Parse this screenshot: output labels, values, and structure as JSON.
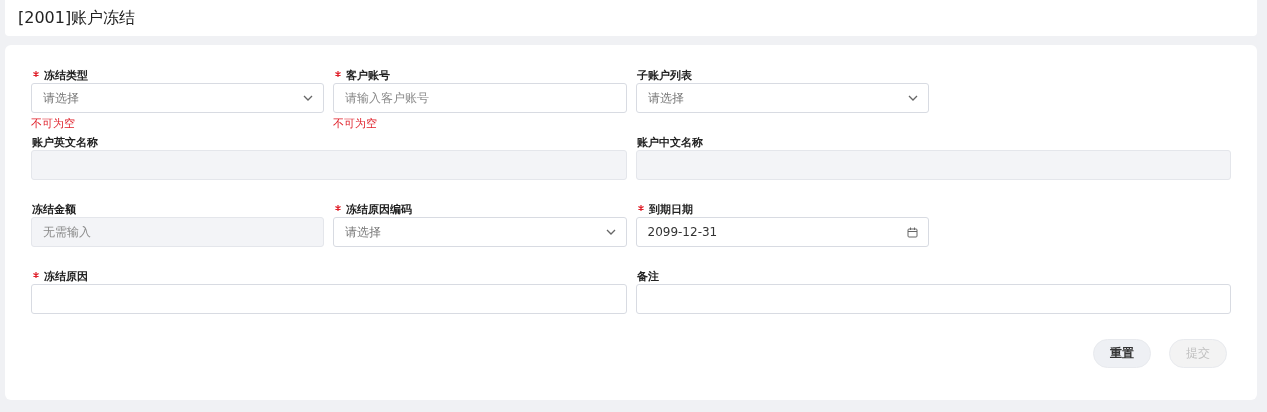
{
  "title": "[2001]账户冻结",
  "rows": [
    [
      {
        "label": "冻结类型",
        "required": true,
        "kind": "select",
        "placeholder": "请选择",
        "disabled": false,
        "error": "不可为空"
      },
      {
        "label": "客户账号",
        "required": true,
        "kind": "input",
        "placeholder": "请输入客户账号",
        "disabled": false,
        "error": "不可为空"
      },
      {
        "label": "子账户列表",
        "required": false,
        "kind": "select",
        "placeholder": "请选择",
        "disabled": false
      }
    ],
    [
      {
        "label": "账户英文名称",
        "required": false,
        "kind": "input",
        "disabled": true
      },
      {
        "label": "账户中文名称",
        "required": false,
        "kind": "input",
        "disabled": true
      }
    ],
    [
      {
        "label": "冻结金额",
        "required": false,
        "kind": "input",
        "placeholder": "无需输入",
        "disabled": true
      },
      {
        "label": "冻结原因编码",
        "required": true,
        "kind": "select",
        "placeholder": "请选择",
        "disabled": false
      },
      {
        "label": "到期日期",
        "required": true,
        "kind": "date",
        "value": "2099-12-31",
        "disabled": false
      }
    ],
    [
      {
        "label": "冻结原因",
        "required": true,
        "kind": "input",
        "disabled": false
      },
      {
        "label": "备注",
        "required": false,
        "kind": "input",
        "disabled": false
      }
    ]
  ],
  "buttons": [
    {
      "label": "重置",
      "disabled": false
    },
    {
      "label": "提交",
      "disabled": true
    }
  ]
}
